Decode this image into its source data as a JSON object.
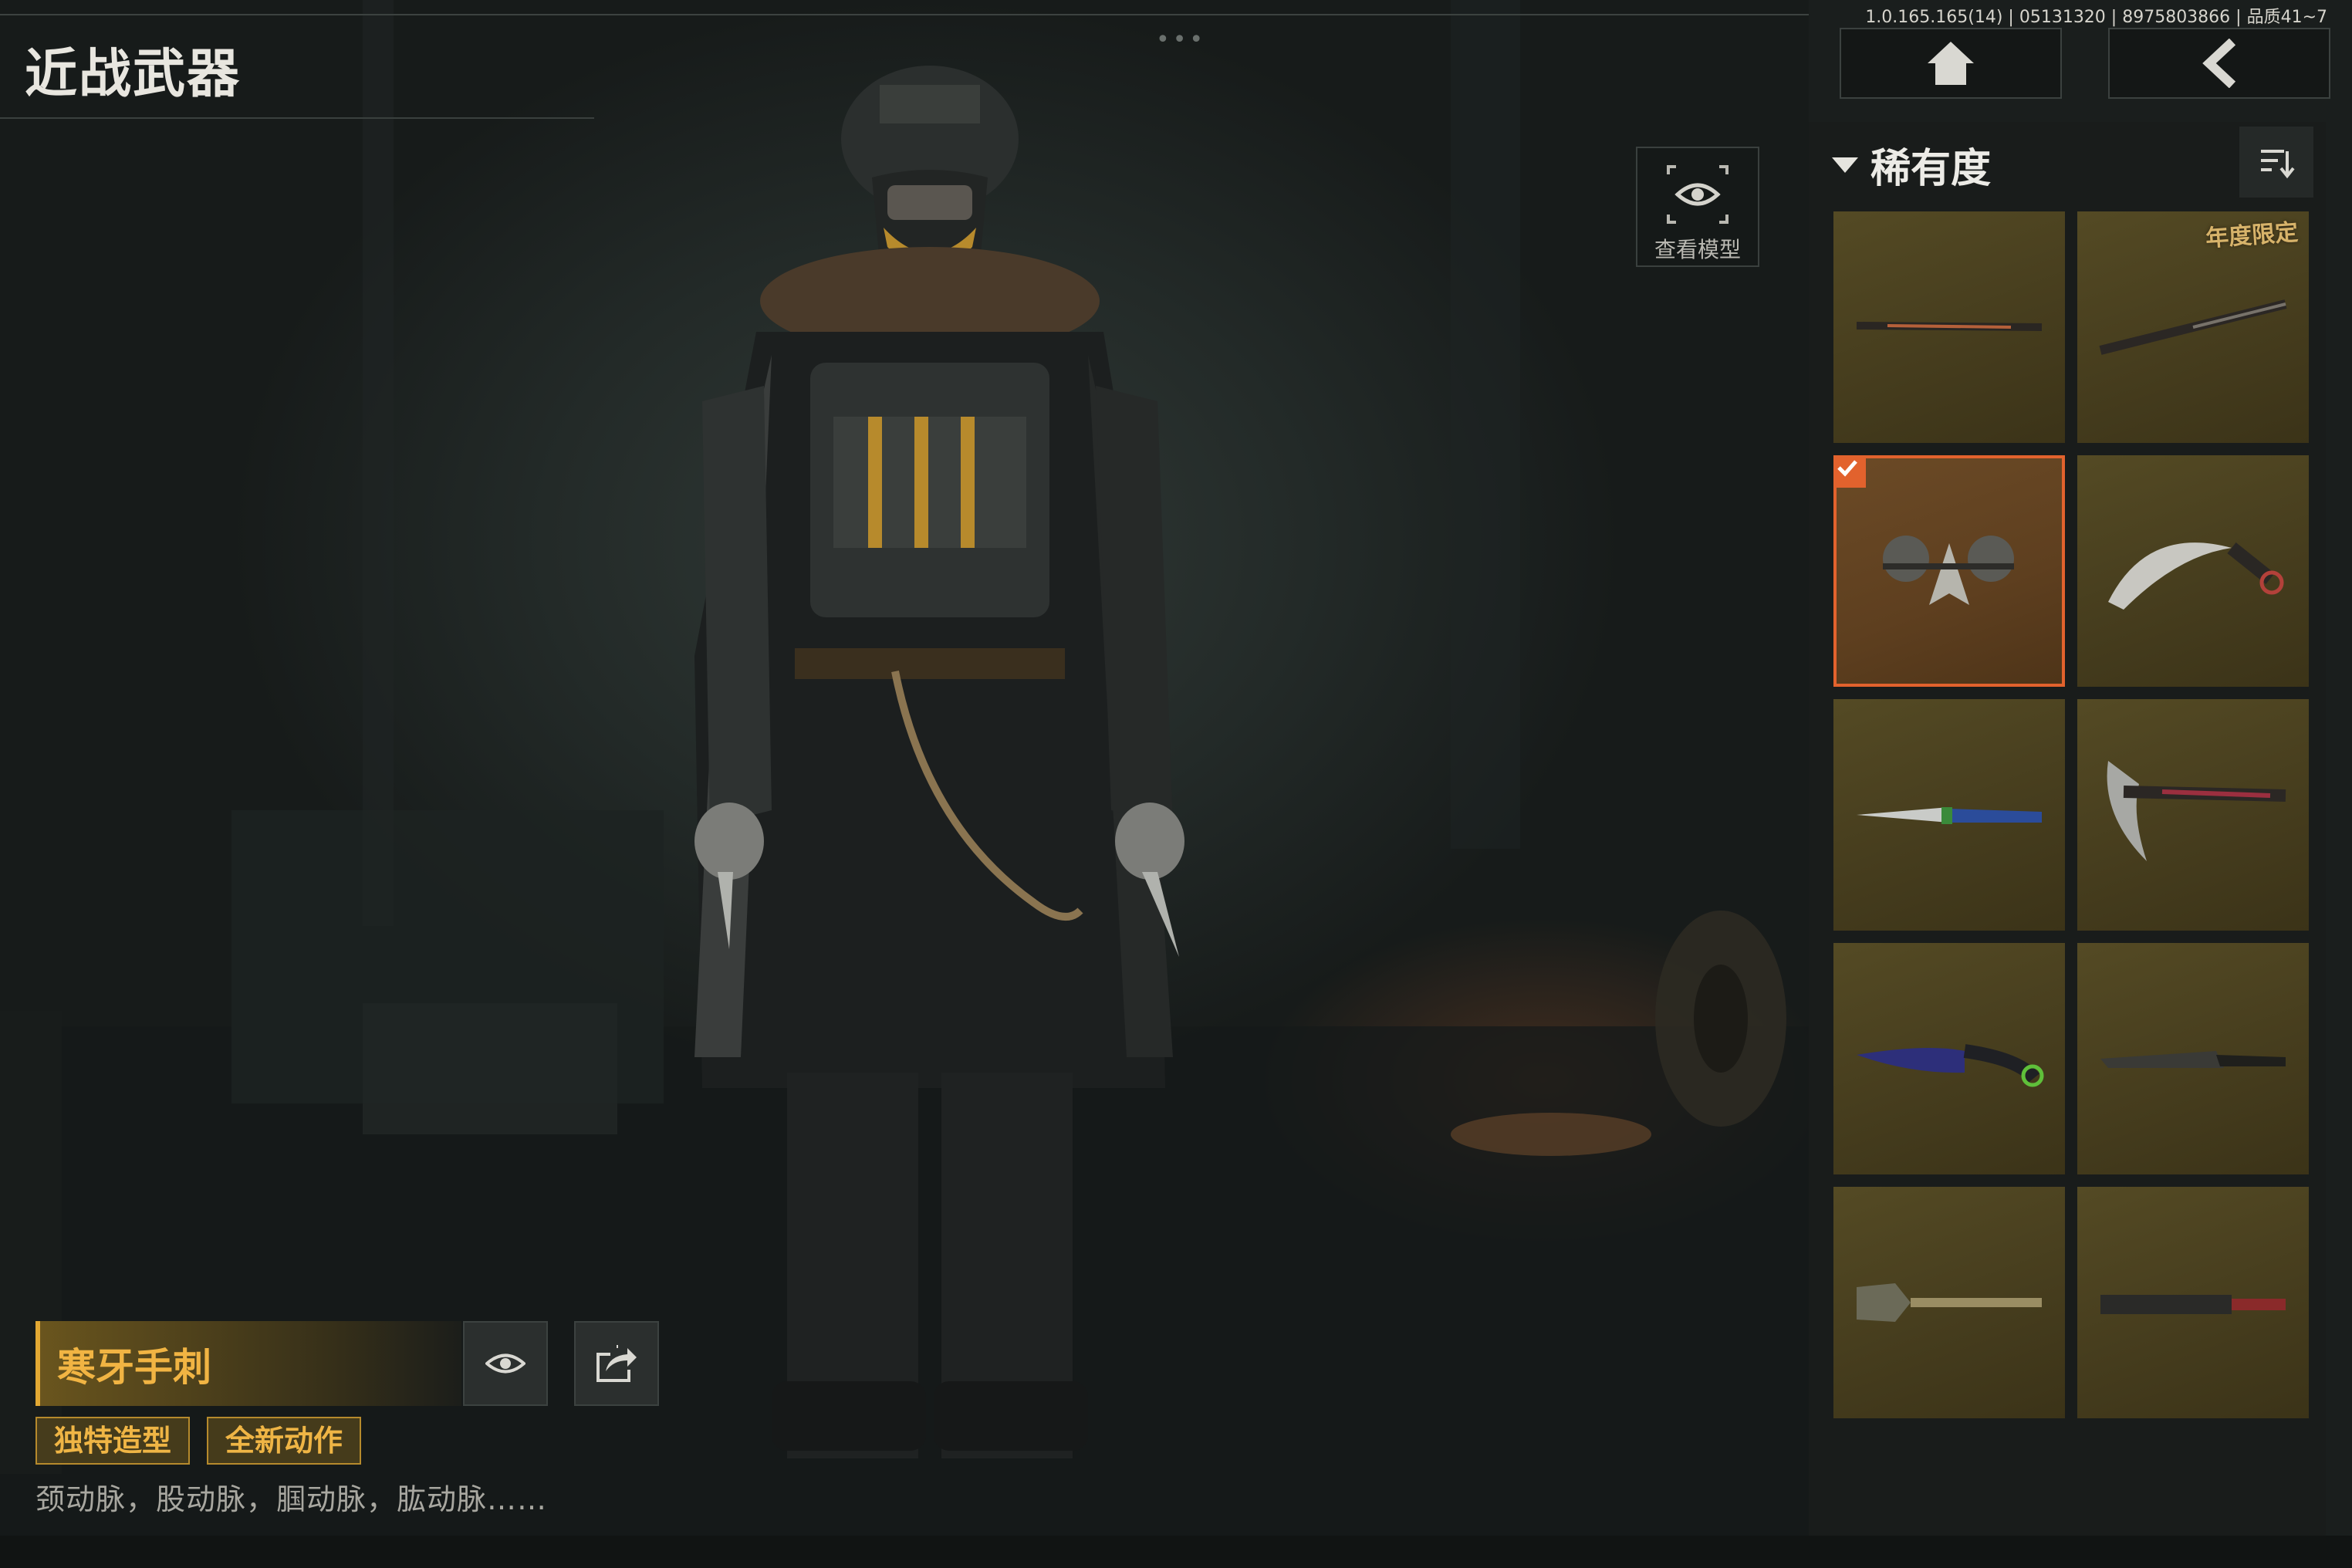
{
  "header": {
    "title": "近战武器",
    "version": "1.0.165.165(14) | 05131320 | 8975803866 | 品质41~7",
    "home_icon": "home-icon",
    "back_icon": "back-arrow-icon"
  },
  "view_model": {
    "label": "查看模型",
    "icon": "eye-icon"
  },
  "panel": {
    "sort_label": "稀有度",
    "sort_icon": "sort-icon",
    "items": [
      {
        "weapon": "staff",
        "selected": false
      },
      {
        "weapon": "sword",
        "selected": false,
        "badge": "年度限定"
      },
      {
        "weapon": "hand-blades",
        "selected": true
      },
      {
        "weapon": "karambit",
        "selected": false
      },
      {
        "weapon": "knife-blue",
        "selected": false
      },
      {
        "weapon": "pickaxe",
        "selected": false
      },
      {
        "weapon": "knife-curved",
        "selected": false
      },
      {
        "weapon": "machete",
        "selected": false
      },
      {
        "weapon": "shovel",
        "selected": false
      },
      {
        "weapon": "cleaver",
        "selected": false
      }
    ]
  },
  "selected_item": {
    "name": "寒牙手刺",
    "tags": [
      "独特造型",
      "全新动作"
    ],
    "description": "颈动脉，股动脉，腘动脉，肱动脉……"
  },
  "colors": {
    "accent": "#e2622d",
    "gold": "#efb545",
    "tile": "#4a4020"
  }
}
